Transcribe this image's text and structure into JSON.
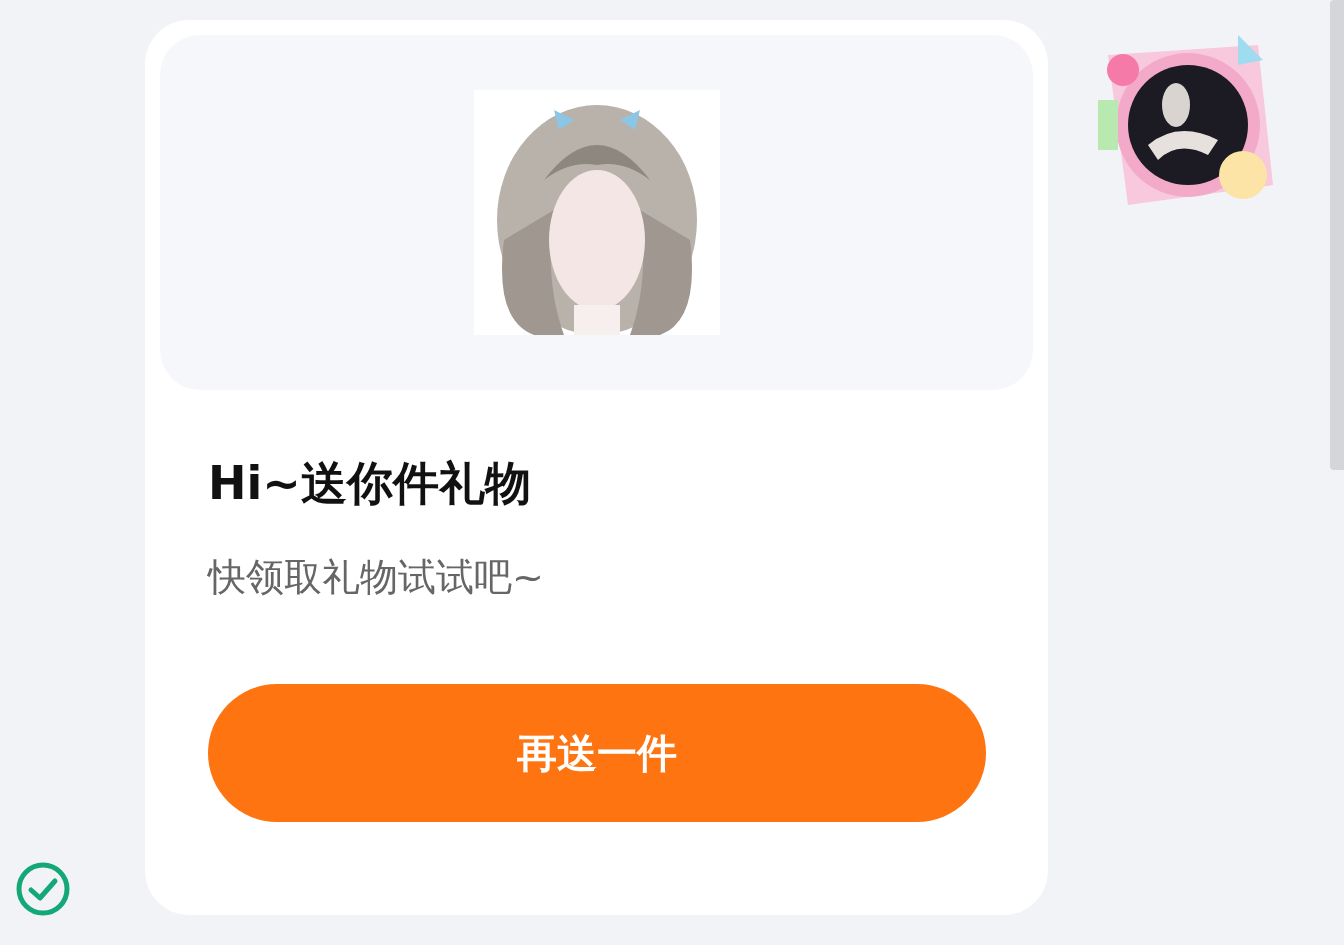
{
  "card": {
    "title": "Hi~送你件礼物",
    "subtitle": "快领取礼物试试吧~",
    "button": "再送一件"
  },
  "status": {
    "delivered": true
  }
}
